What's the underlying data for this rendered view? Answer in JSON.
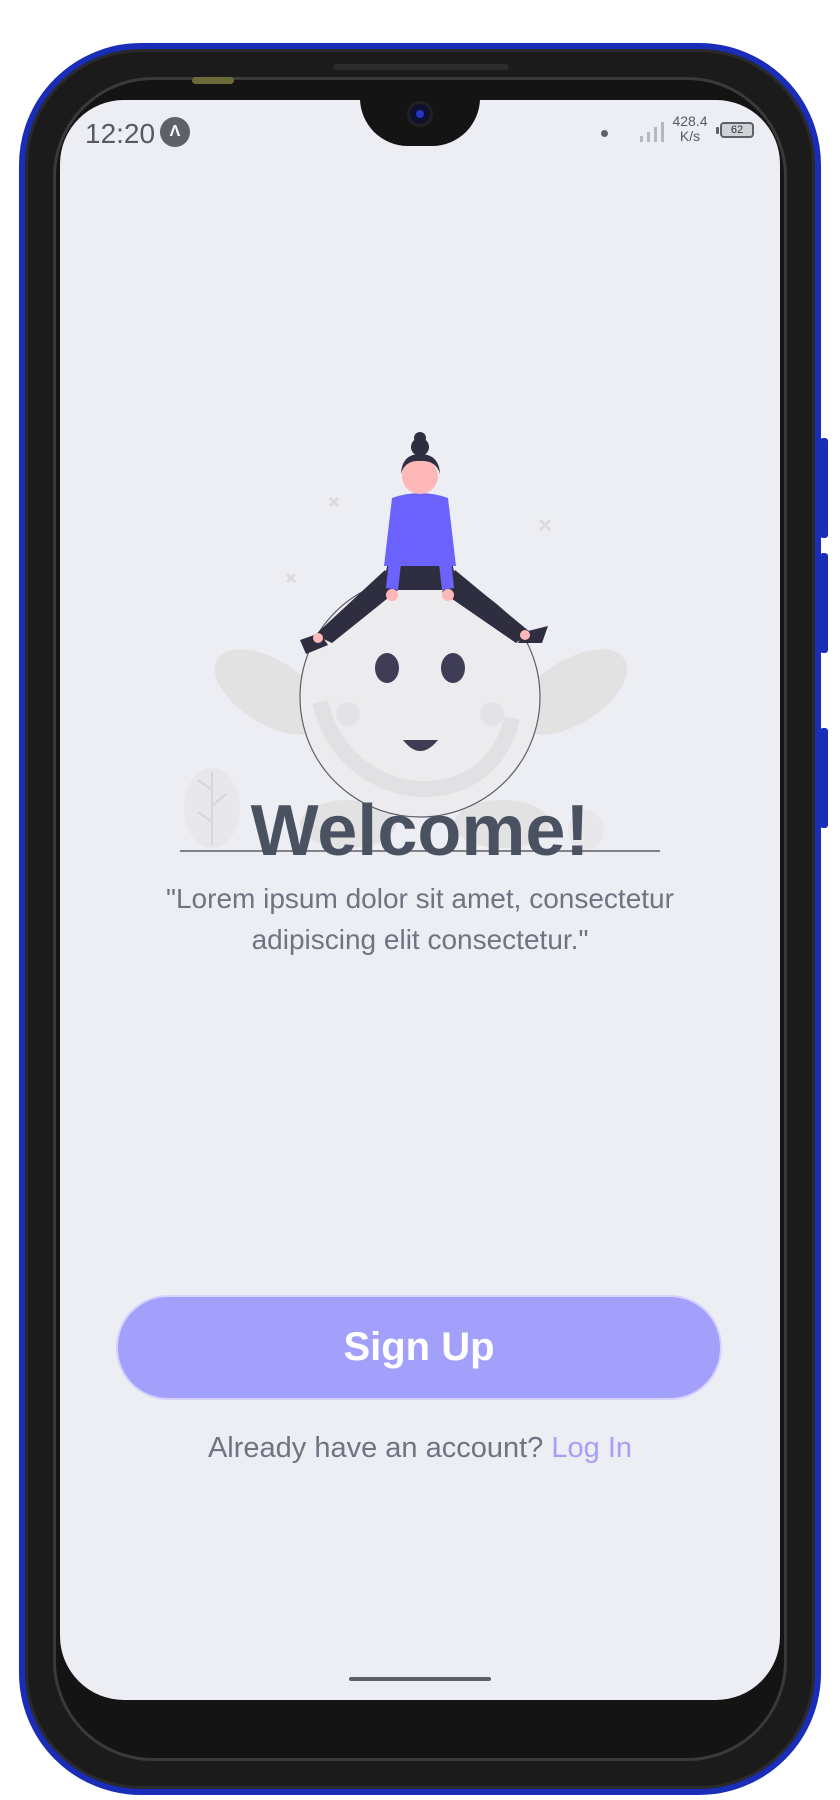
{
  "status_bar": {
    "time": "12:20",
    "app_badge_icon": "expo-icon",
    "net_speed_value": "428.4",
    "net_speed_unit": "K/s",
    "battery_level": "62"
  },
  "welcome": {
    "title": "Welcome!",
    "subtitle": "\"Lorem ipsum dolor sit amet, consectetur adipiscing elit consectetur.\"",
    "illustration_icon": "woman-on-ball-illustration"
  },
  "actions": {
    "signup_label": "Sign Up",
    "login_prompt": "Already have an account?",
    "login_label": "Log In"
  },
  "colors": {
    "accent": "#a3a0fb",
    "illustration_primary": "#6c63ff",
    "text_dark": "#4a5160",
    "text_muted": "#6e7482",
    "background": "#eceef3",
    "frame": "#1a2db8"
  }
}
